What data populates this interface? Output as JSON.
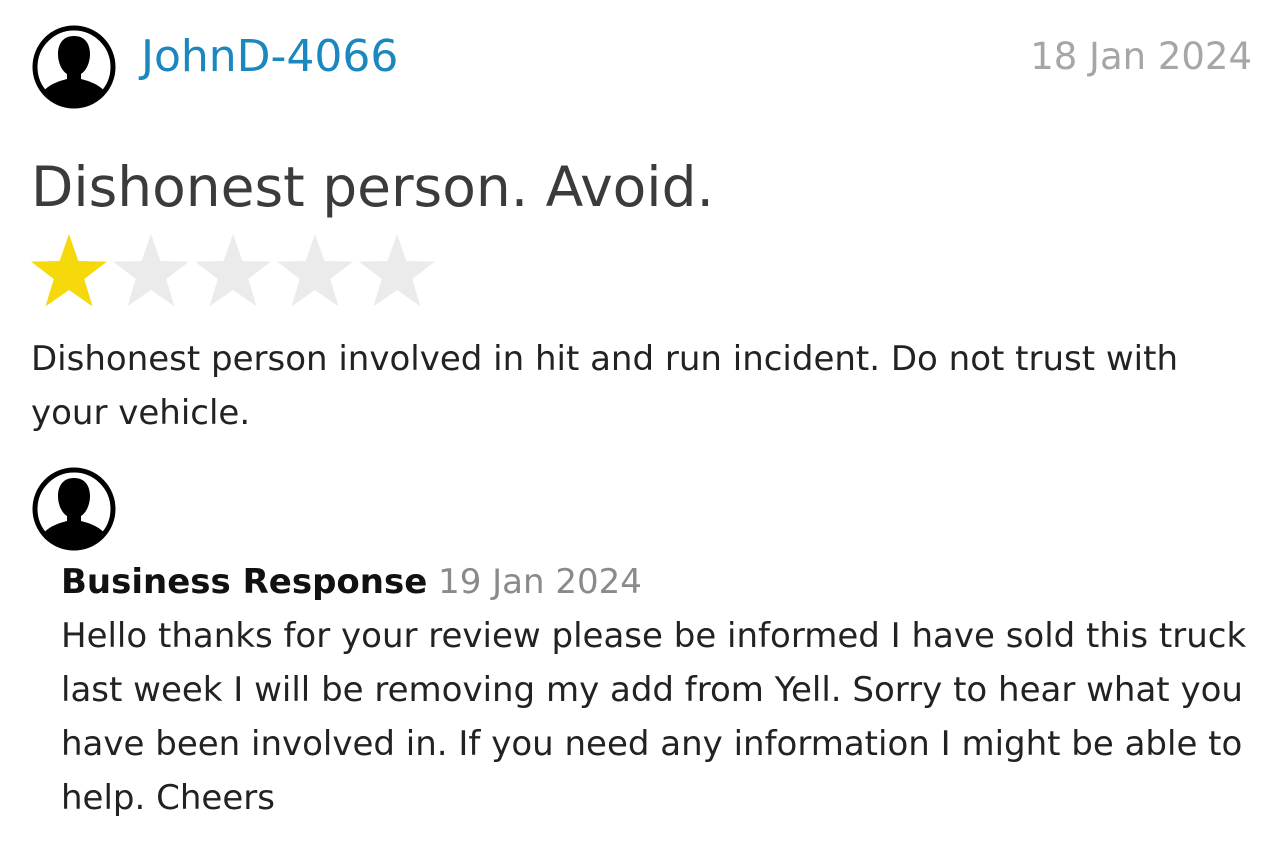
{
  "review": {
    "reviewer_name": "JohnD-4066",
    "date": "18 Jan 2024",
    "title": "Dishonest person. Avoid.",
    "rating": 1,
    "rating_max": 5,
    "body": "Dishonest person involved in hit and run incident. Do not trust with your vehicle.",
    "avatar_icon": "user-silhouette-icon"
  },
  "business_response": {
    "label": "Business Response",
    "date": "19 Jan 2024",
    "body": "Hello thanks for your review please be informed I have sold this truck last week I will be removing my add from Yell. Sorry to hear what you have been involved in. If you need any information I might be able to help. Cheers",
    "avatar_icon": "user-silhouette-icon"
  },
  "colors": {
    "link": "#1a87be",
    "star_filled": "#f5d90a",
    "star_empty": "#ebebeb",
    "muted_text": "#a6a6a6"
  }
}
